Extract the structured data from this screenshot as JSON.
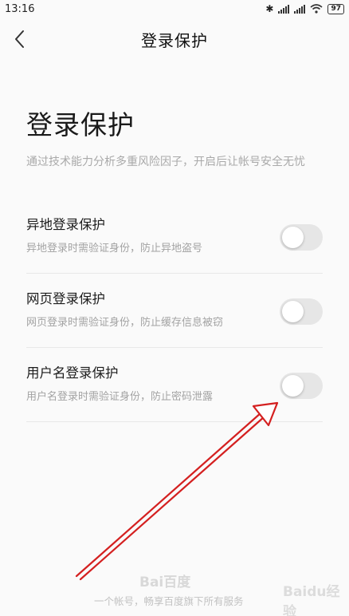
{
  "status_bar": {
    "time": "13:16",
    "battery": "97"
  },
  "nav": {
    "title": "登录保护"
  },
  "main": {
    "heading": "登录保护",
    "description": "通过技术能力分析多重风险因子，开启后让帐号安全无忧"
  },
  "settings": [
    {
      "title": "异地登录保护",
      "subtitle": "异地登录时需验证身份，防止异地盗号",
      "enabled": false
    },
    {
      "title": "网页登录保护",
      "subtitle": "网页登录时需验证身份，防止缓存信息被窃",
      "enabled": false
    },
    {
      "title": "用户名登录保护",
      "subtitle": "用户名登录时需验证身份，防止密码泄露",
      "enabled": false
    }
  ],
  "footer": {
    "logo": "Bai百度",
    "tagline": "一个帐号，畅享百度旗下所有服务"
  },
  "watermark": "Baidu经验",
  "colors": {
    "annotation_arrow": "#d42020",
    "toggle_off": "#e6e6e6"
  }
}
